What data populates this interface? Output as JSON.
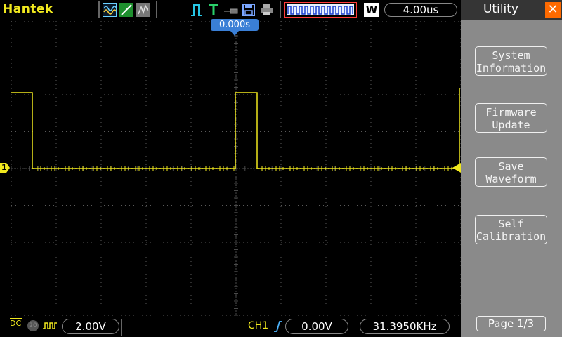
{
  "header": {
    "brand": "Hantek",
    "w_badge": "W",
    "timebase": "4.00us",
    "trigger_position": "0.000s"
  },
  "panel": {
    "title": "Utility",
    "close_glyph": "✕",
    "buttons": [
      {
        "line1": "System",
        "line2": "Information"
      },
      {
        "line1": "Firmware",
        "line2": "Update"
      },
      {
        "line1": "Save",
        "line2": "Waveform"
      },
      {
        "line1": "Self",
        "line2": "Calibration"
      }
    ],
    "page": "Page 1/3"
  },
  "footer": {
    "coupling": "DC",
    "bw_limit": "20",
    "ch1_scale": "2.00V",
    "trigger_channel": "CH1",
    "trigger_level": "0.00V",
    "frequency": "31.3950KHz"
  },
  "channel_marker": "1",
  "colors": {
    "trace": "#f0e81e",
    "grid": "#5a5a5a",
    "accent": "#3a7fd6",
    "close": "#ff6a00"
  },
  "icons": [
    "sine-wave-icon",
    "ramp-icon",
    "noise-icon",
    "pulse-icon",
    "trigger-icon",
    "probe-icon",
    "save-icon",
    "print-icon",
    "waveform-preview-icon"
  ]
}
